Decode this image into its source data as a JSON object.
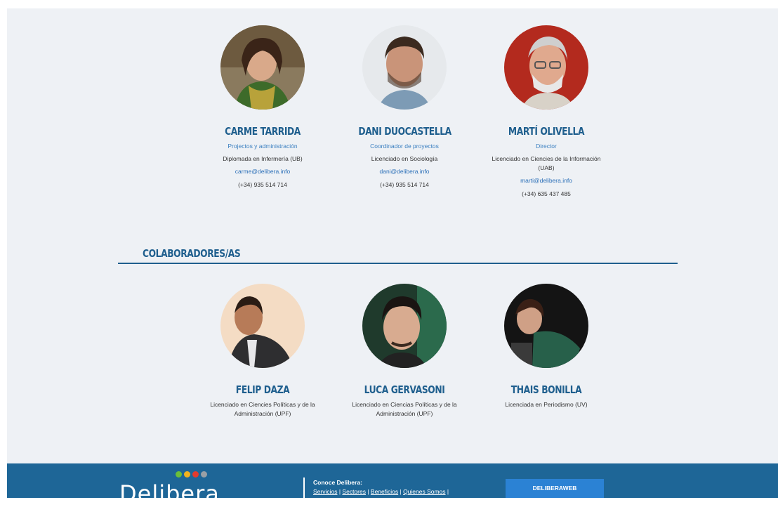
{
  "team": [
    {
      "name": "CARME TARRIDA",
      "role": "Projectos y administración",
      "desc": "Diplomada en Infermería (UB)",
      "email": "carme@delibera.info",
      "phone": "(+34) 935 514 714"
    },
    {
      "name": "DANI DUOCASTELLA",
      "role": "Coordinador de proyectos",
      "desc": "Licenciado en Sociología",
      "email": "dani@delibera.info",
      "phone": "(+34) 935 514 714"
    },
    {
      "name": "MARTÍ OLIVELLA",
      "role": "Director",
      "desc": "Licenciado en Ciencies de la Información (UAB)",
      "email": "marti@delibera.info",
      "phone": "(+34) 635 437 485"
    }
  ],
  "collab_title": "COLABORADORES/AS",
  "collaborators": [
    {
      "name": "FELIP DAZA",
      "desc": "Licenciado en Ciencies Políticas y de la Administración (UPF)"
    },
    {
      "name": "LUCA GERVASONI",
      "desc": "Licenciado en Ciencias Políticas y de la Administración (UPF)"
    },
    {
      "name": "THAIS BONILLA",
      "desc": "Licenciada en Periodismo (UV)"
    }
  ],
  "footer": {
    "logo": "Delibera",
    "conoce_title": "Conoce Delibera:",
    "links": [
      "Servicios",
      "Sectores",
      "Beneficios",
      "Quienes Somos"
    ],
    "button": "DELIBERAWEB"
  },
  "colors": {
    "accent": "#1f5f8e",
    "footer": "#1e6697",
    "link": "#2c70b8"
  }
}
